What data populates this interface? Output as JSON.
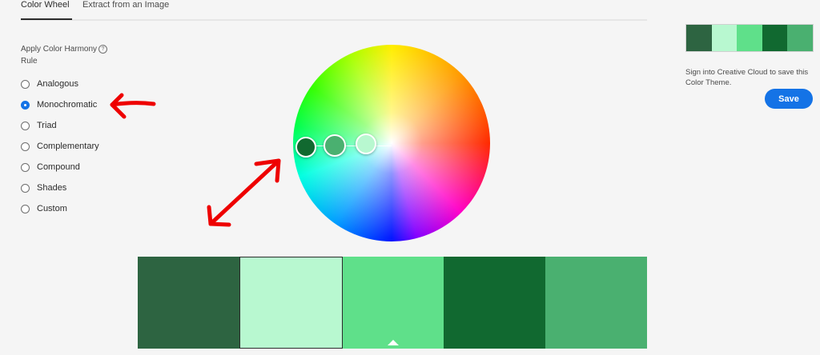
{
  "tabs": [
    {
      "label": "Color Wheel",
      "active": true
    },
    {
      "label": "Extract from an Image",
      "active": false
    }
  ],
  "harmony": {
    "title": "Apply Color Harmony Rule",
    "help_icon": "question-circle-icon",
    "options": [
      {
        "label": "Analogous",
        "checked": false
      },
      {
        "label": "Monochromatic",
        "checked": true
      },
      {
        "label": "Triad",
        "checked": false
      },
      {
        "label": "Complementary",
        "checked": false
      },
      {
        "label": "Compound",
        "checked": false
      },
      {
        "label": "Shades",
        "checked": false
      },
      {
        "label": "Custom",
        "checked": false
      }
    ]
  },
  "theme": {
    "colors": [
      "#2d6441",
      "#b8f8d0",
      "#5fe08a",
      "#116930",
      "#4ab070"
    ],
    "selected_index": 1
  },
  "sidebar": {
    "sign_in_text": "Sign into Creative Cloud to save this Color Theme.",
    "save_label": "Save"
  },
  "annotations": {
    "color": "#ee0000"
  }
}
